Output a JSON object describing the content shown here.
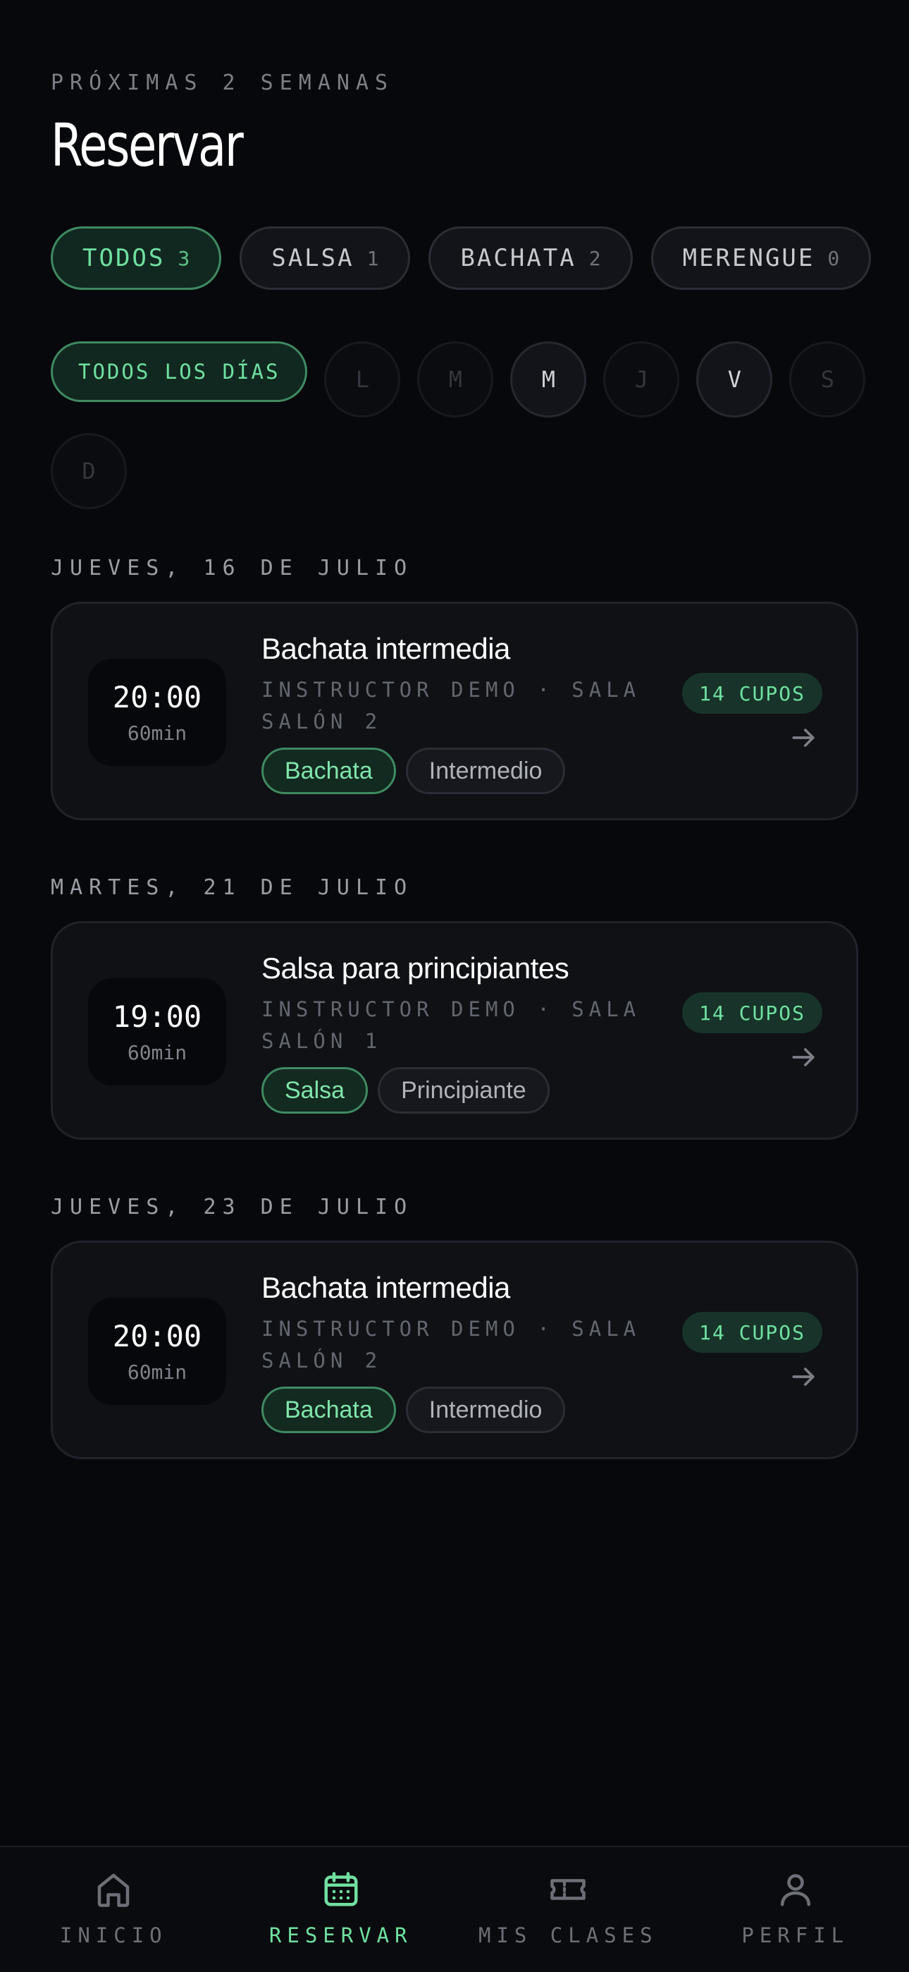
{
  "header": {
    "eyebrow": "PRÓXIMAS 2 SEMANAS",
    "title": "Reservar"
  },
  "style_filters": [
    {
      "label": "TODOS",
      "count": "3",
      "active": true
    },
    {
      "label": "SALSA",
      "count": "1",
      "active": false
    },
    {
      "label": "BACHATA",
      "count": "2",
      "active": false
    },
    {
      "label": "MERENGUE",
      "count": "0",
      "active": false
    }
  ],
  "day_filters": {
    "all_label": "TODOS LOS DÍAS",
    "days": [
      "L",
      "M",
      "M",
      "J",
      "V",
      "S",
      "D"
    ]
  },
  "sections": [
    {
      "date": "JUEVES, 16 DE JULIO",
      "card": {
        "time": "20:00",
        "duration": "60min",
        "title": "Bachata intermedia",
        "meta": "INSTRUCTOR DEMO · SALA SALÓN 2",
        "tag_style": "Bachata",
        "tag_level": "Intermedio",
        "spots": "14 CUPOS"
      }
    },
    {
      "date": "MARTES, 21 DE JULIO",
      "card": {
        "time": "19:00",
        "duration": "60min",
        "title": "Salsa para principiantes",
        "meta": "INSTRUCTOR DEMO · SALA SALÓN 1",
        "tag_style": "Salsa",
        "tag_level": "Principiante",
        "spots": "14 CUPOS"
      }
    },
    {
      "date": "JUEVES, 23 DE JULIO",
      "card": {
        "time": "20:00",
        "duration": "60min",
        "title": "Bachata intermedia",
        "meta": "INSTRUCTOR DEMO · SALA SALÓN 2",
        "tag_style": "Bachata",
        "tag_level": "Intermedio",
        "spots": "14 CUPOS"
      }
    }
  ],
  "tabbar": [
    {
      "label": "INICIO",
      "icon": "home-icon"
    },
    {
      "label": "RESERVAR",
      "icon": "calendar-icon"
    },
    {
      "label": "MIS CLASES",
      "icon": "ticket-icon"
    },
    {
      "label": "PERFIL",
      "icon": "user-icon"
    }
  ],
  "colors": {
    "accent": "#6fe0a0",
    "background": "#07080b",
    "card": "#0f1115"
  }
}
